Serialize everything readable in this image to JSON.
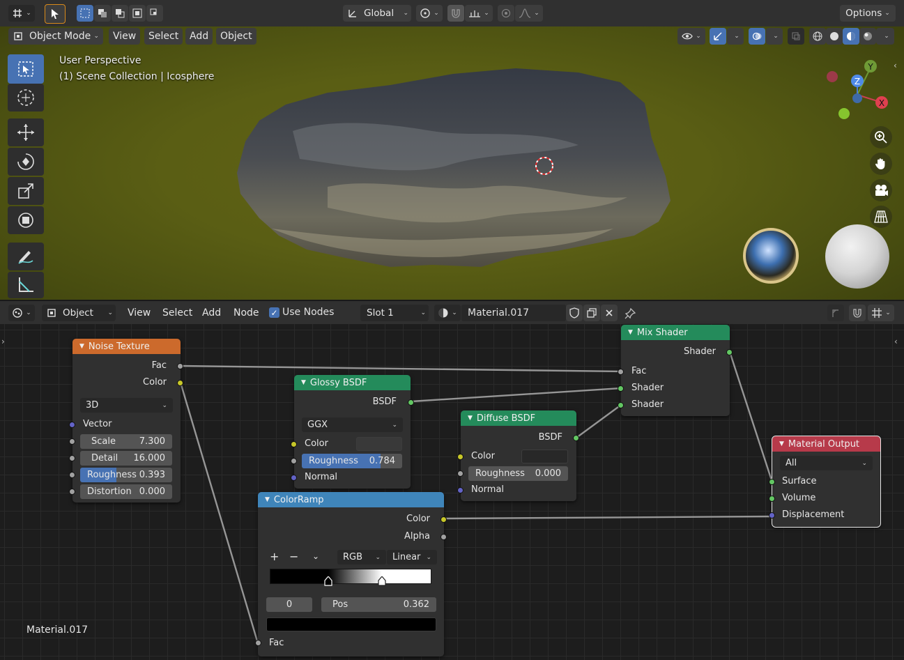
{
  "top_header": {
    "transform_orientation": "Global",
    "options_label": "Options"
  },
  "viewport_header": {
    "mode": "Object Mode",
    "menus": [
      "View",
      "Select",
      "Add",
      "Object"
    ]
  },
  "viewport": {
    "perspective": "User Perspective",
    "collection": "(1) Scene Collection | Icosphere",
    "gizmo": {
      "x": "X",
      "y": "Y",
      "z": "Z"
    }
  },
  "node_header": {
    "editor_type": "Object",
    "menus": [
      "View",
      "Select",
      "Add",
      "Node"
    ],
    "use_nodes_label": "Use Nodes",
    "use_nodes_checked": true,
    "slot": "Slot 1",
    "material": "Material.017"
  },
  "nodes": {
    "noise": {
      "title": "Noise Texture",
      "out_fac": "Fac",
      "out_color": "Color",
      "dimension": "3D",
      "vector": "Vector",
      "scale_label": "Scale",
      "scale_value": "7.300",
      "detail_label": "Detail",
      "detail_value": "16.000",
      "roughness_label": "Roughness",
      "roughness_value": "0.393",
      "roughness_fraction": 0.393,
      "distortion_label": "Distortion",
      "distortion_value": "0.000"
    },
    "glossy": {
      "title": "Glossy BSDF",
      "out_bsdf": "BSDF",
      "distribution": "GGX",
      "color": "Color",
      "roughness_label": "Roughness",
      "roughness_value": "0.784",
      "roughness_fraction": 0.784,
      "normal": "Normal"
    },
    "diffuse": {
      "title": "Diffuse BSDF",
      "out_bsdf": "BSDF",
      "color": "Color",
      "roughness_label": "Roughness",
      "roughness_value": "0.000",
      "normal": "Normal"
    },
    "mix": {
      "title": "Mix Shader",
      "out_shader": "Shader",
      "fac": "Fac",
      "shader1": "Shader",
      "shader2": "Shader"
    },
    "output": {
      "title": "Material Output",
      "target": "All",
      "surface": "Surface",
      "volume": "Volume",
      "displacement": "Displacement"
    },
    "colorramp": {
      "title": "ColorRamp",
      "out_color": "Color",
      "out_alpha": "Alpha",
      "plus": "+",
      "minus": "−",
      "color_mode": "RGB",
      "interpolation": "Linear",
      "active_index": "0",
      "pos_label": "Pos",
      "pos_value": "0.362",
      "stops": [
        0.362,
        0.695
      ],
      "in_fac": "Fac"
    }
  },
  "material_label": "Material.017",
  "colors": {
    "header_bg": "#303030",
    "accent_blue": "#4772b3",
    "texture_header": "#cc6a2c",
    "shader_header": "#248b5b",
    "converter_header": "#3f85ba",
    "output_header": "#b73a4a"
  }
}
